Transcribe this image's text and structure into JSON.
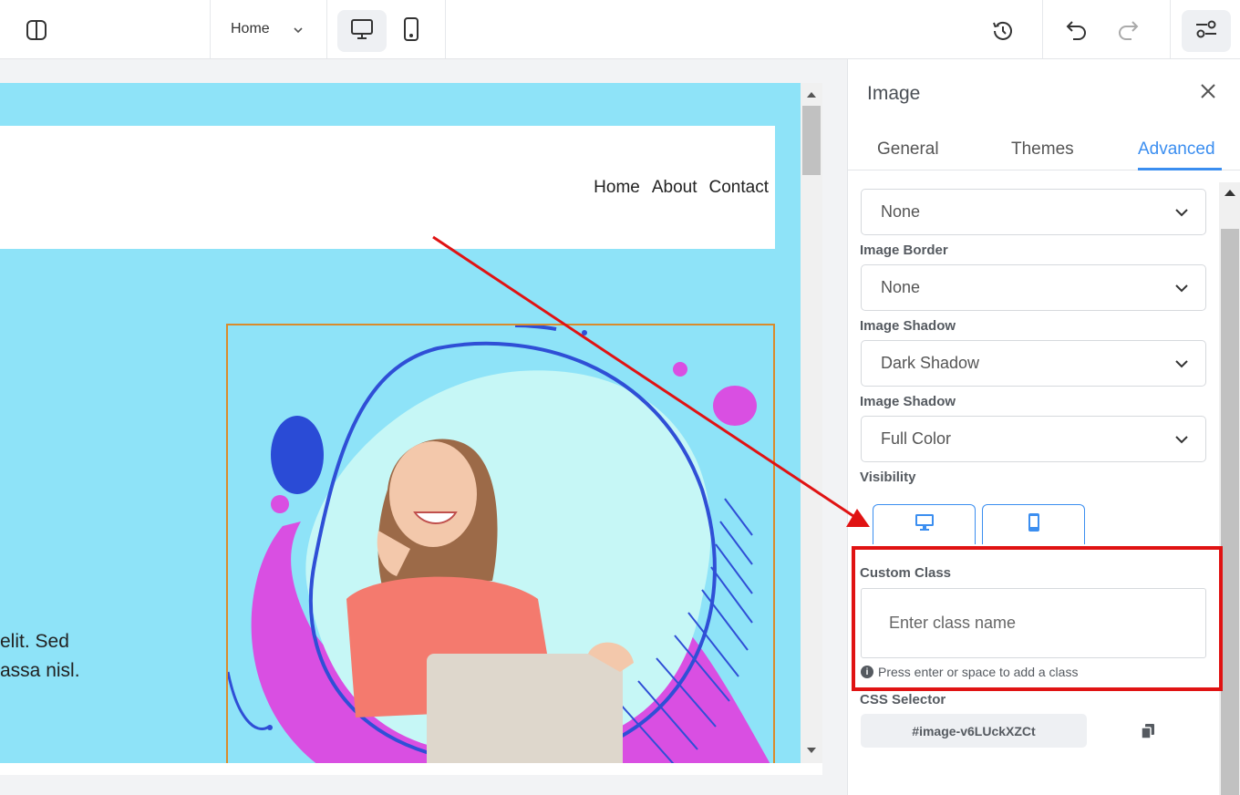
{
  "toolbar": {
    "page_select_value": "Home"
  },
  "canvas": {
    "nav_items": [
      "Home",
      "About",
      "Contact"
    ],
    "text_line_1": "elit. Sed",
    "text_line_2": "assa nisl."
  },
  "panel": {
    "title": "Image",
    "tabs": [
      {
        "label": "General",
        "active": false
      },
      {
        "label": "Themes",
        "active": false
      },
      {
        "label": "Advanced",
        "active": true
      }
    ],
    "fields": [
      {
        "label": "",
        "value": "None"
      },
      {
        "label": "Image Border",
        "value": "None"
      },
      {
        "label": "Image Shadow",
        "value": "Dark Shadow"
      },
      {
        "label": "Image Shadow",
        "value": "Full Color"
      }
    ],
    "visibility_label": "Visibility",
    "custom_class_label": "Custom Class",
    "custom_class_placeholder": "Enter class name",
    "custom_class_hint": "Press enter or space to add a class",
    "css_selector_label": "CSS Selector",
    "css_selector_value": "#image-v6LUckXZCt"
  },
  "colors": {
    "accent": "#3b8ef0",
    "canvas_bg": "#8ee3f8",
    "annotation_red": "#e01313"
  }
}
